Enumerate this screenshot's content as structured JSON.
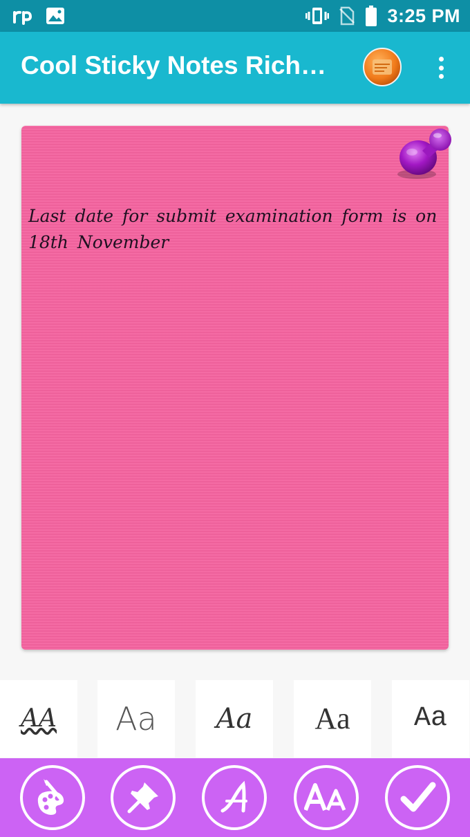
{
  "status_bar": {
    "time": "3:25 PM",
    "icons": [
      "carrier-logo-icon",
      "image-notification-icon",
      "vibrate-icon",
      "no-sim-icon",
      "battery-icon"
    ]
  },
  "app_bar": {
    "title": "Cool Sticky Notes Rich…",
    "logo_icon": "app-logo-icon",
    "menu_icon": "overflow-menu-icon"
  },
  "note": {
    "text": "Last date for submit examination form is on 18th November",
    "background_color": "#f4639f",
    "pin_icon": "push-pin-icon"
  },
  "font_options": [
    {
      "sample": "AA",
      "icon": "font-style-1"
    },
    {
      "sample": "Aa",
      "icon": "font-style-2"
    },
    {
      "sample": "Aa",
      "icon": "font-style-3"
    },
    {
      "sample": "Aa",
      "icon": "font-style-4"
    },
    {
      "sample": "Aa",
      "icon": "font-style-5"
    }
  ],
  "toolbar": {
    "buttons": [
      {
        "icon": "palette-icon"
      },
      {
        "icon": "pin-icon"
      },
      {
        "icon": "font-style-icon"
      },
      {
        "icon": "font-size-icon"
      },
      {
        "icon": "checkmark-icon"
      }
    ],
    "font_size_glyph": "AA",
    "font_style_glyph": "A"
  },
  "colors": {
    "status_bar": "#0e8fa5",
    "app_bar": "#19b8cf",
    "note": "#f4639f",
    "toolbar": "#cc63f4"
  }
}
